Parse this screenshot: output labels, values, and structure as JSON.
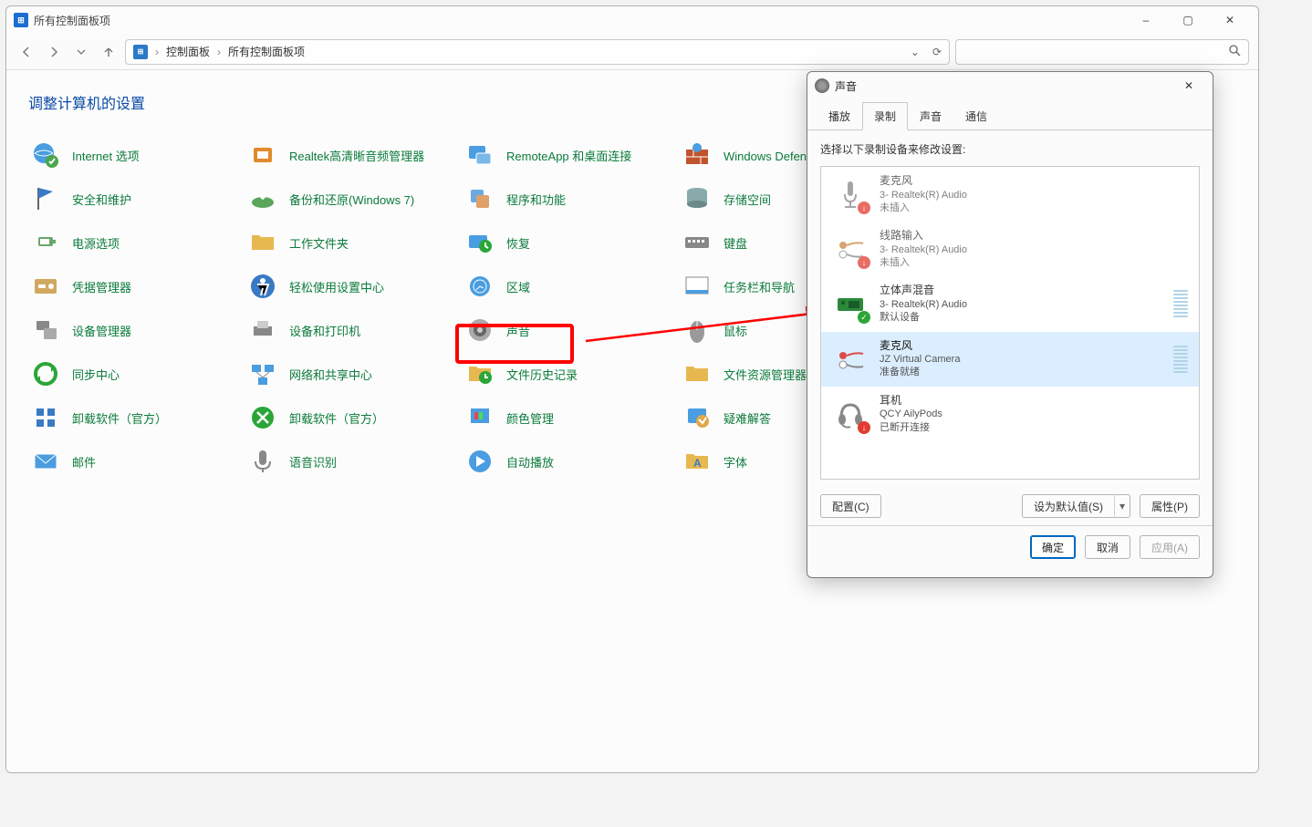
{
  "window": {
    "title": "所有控制面板项",
    "controls": {
      "minimize": "–",
      "maximize": "▢",
      "close": "✕"
    }
  },
  "toolbar": {
    "address_crumb1": "控制面板",
    "address_crumb2": "所有控制面板项",
    "search_placeholder": ""
  },
  "heading": "调整计算机的设置",
  "cp_items": [
    {
      "label": "Internet 选项",
      "icon": "globe-check-icon"
    },
    {
      "label": "Realtek高清晰音频管理器",
      "icon": "audio-chip-icon"
    },
    {
      "label": "RemoteApp 和桌面连接",
      "icon": "remote-desktop-icon"
    },
    {
      "label": "Windows Defender 防火墙",
      "icon": "firewall-icon"
    },
    {
      "label": "安全和维护",
      "icon": "flag-icon"
    },
    {
      "label": "备份和还原(Windows 7)",
      "icon": "backup-icon"
    },
    {
      "label": "程序和功能",
      "icon": "programs-icon"
    },
    {
      "label": "存储空间",
      "icon": "storage-icon"
    },
    {
      "label": "电源选项",
      "icon": "power-icon"
    },
    {
      "label": "工作文件夹",
      "icon": "folder-icon"
    },
    {
      "label": "恢复",
      "icon": "recovery-icon"
    },
    {
      "label": "键盘",
      "icon": "keyboard-icon"
    },
    {
      "label": "凭据管理器",
      "icon": "credential-icon"
    },
    {
      "label": "轻松使用设置中心",
      "icon": "ease-access-icon"
    },
    {
      "label": "区域",
      "icon": "region-icon"
    },
    {
      "label": "任务栏和导航",
      "icon": "taskbar-icon"
    },
    {
      "label": "设备管理器",
      "icon": "device-manager-icon"
    },
    {
      "label": "设备和打印机",
      "icon": "devices-printers-icon"
    },
    {
      "label": "声音",
      "icon": "speaker-icon"
    },
    {
      "label": "鼠标",
      "icon": "mouse-icon"
    },
    {
      "label": "同步中心",
      "icon": "sync-icon"
    },
    {
      "label": "网络和共享中心",
      "icon": "network-icon"
    },
    {
      "label": "文件历史记录",
      "icon": "file-history-icon"
    },
    {
      "label": "文件资源管理器选项",
      "icon": "explorer-options-icon"
    },
    {
      "label": "卸载软件（官方）",
      "icon": "uninstall-blue-icon"
    },
    {
      "label": "卸载软件（官方）",
      "icon": "uninstall-green-icon"
    },
    {
      "label": "颜色管理",
      "icon": "color-mgmt-icon"
    },
    {
      "label": "疑难解答",
      "icon": "troubleshoot-icon"
    },
    {
      "label": "邮件",
      "icon": "mail-icon"
    },
    {
      "label": "语音识别",
      "icon": "speech-icon"
    },
    {
      "label": "自动播放",
      "icon": "autoplay-icon"
    },
    {
      "label": "字体",
      "icon": "font-icon"
    }
  ],
  "dialog": {
    "title": "声音",
    "close": "✕",
    "tabs": [
      "播放",
      "录制",
      "声音",
      "通信"
    ],
    "active_tab": 1,
    "instruction": "选择以下录制设备来修改设置:",
    "devices": [
      {
        "name": "麦克风",
        "detail": "3- Realtek(R) Audio",
        "status": "未插入",
        "badge": "red",
        "icon": "mic-icon",
        "selected": false
      },
      {
        "name": "线路输入",
        "detail": "3- Realtek(R) Audio",
        "status": "未插入",
        "badge": "red",
        "icon": "line-in-icon",
        "selected": false
      },
      {
        "name": "立体声混音",
        "detail": "3- Realtek(R) Audio",
        "status": "默认设备",
        "badge": "green",
        "icon": "stereo-mix-icon",
        "selected": false,
        "level": true
      },
      {
        "name": "麦克风",
        "detail": "JZ Virtual Camera",
        "status": "准备就绪",
        "badge": "",
        "icon": "plug-icon",
        "selected": true,
        "level": true
      },
      {
        "name": "耳机",
        "detail": "QCY AilyPods",
        "status": "已断开连接",
        "badge": "red",
        "icon": "headset-icon",
        "selected": false
      }
    ],
    "buttons": {
      "configure": "配置(C)",
      "set_default": "设为默认值(S)",
      "properties": "属性(P)",
      "ok": "确定",
      "cancel": "取消",
      "apply": "应用(A)"
    }
  }
}
